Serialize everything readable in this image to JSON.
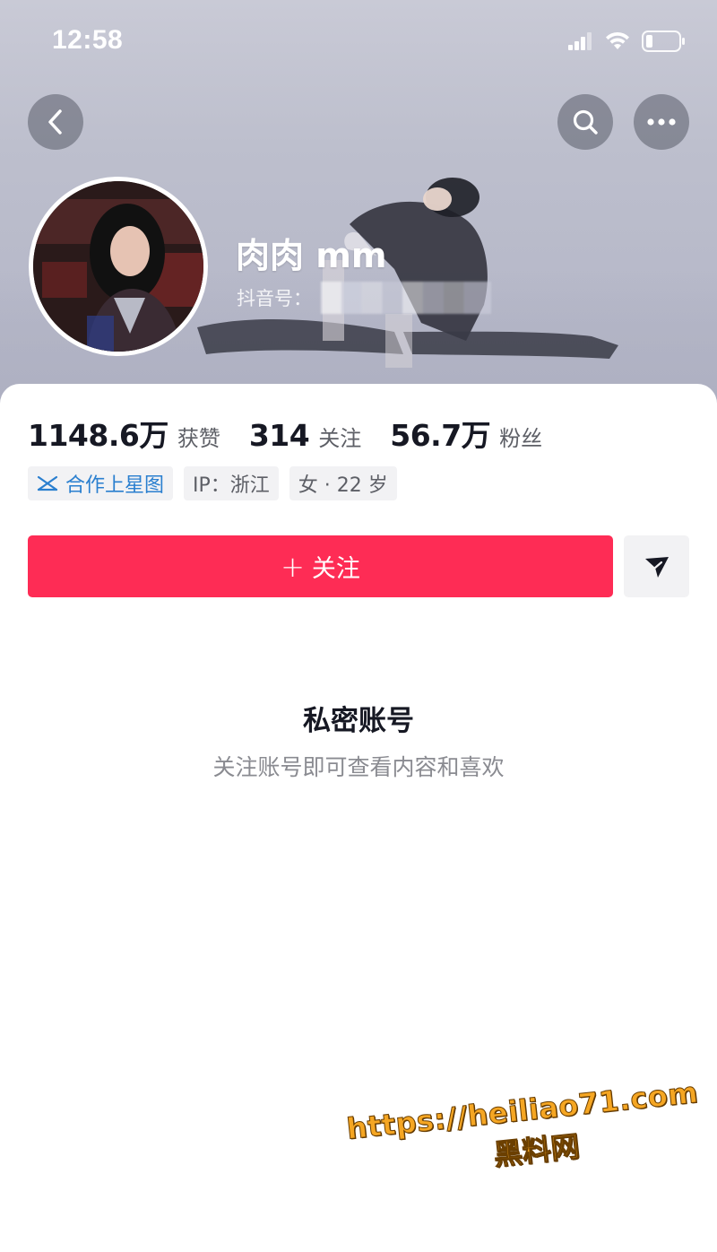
{
  "status_bar": {
    "time": "12:58",
    "icons": [
      "signal-icon",
      "wifi-icon",
      "battery-icon"
    ]
  },
  "nav": {
    "back_icon": "chevron-left-icon",
    "search_icon": "search-icon",
    "more_icon": "more-dots-icon"
  },
  "profile": {
    "nickname": "肉肉 mm",
    "douyin_id_label": "抖音号："
  },
  "stats": [
    {
      "value": "1148.6万",
      "label": "获赞"
    },
    {
      "value": "314",
      "label": "关注"
    },
    {
      "value": "56.7万",
      "label": "粉丝"
    }
  ],
  "tags": {
    "star": "合作上星图",
    "ip": "IP：浙江",
    "gender_age": "女 · 22 岁"
  },
  "actions": {
    "follow_plus": "+",
    "follow_label": "关注",
    "share_icon": "send-icon"
  },
  "private": {
    "title": "私密账号",
    "subtitle": "关注账号即可查看内容和喜欢"
  },
  "watermark": {
    "url": "https://heiliao71.com",
    "name": "黑料网"
  },
  "colors": {
    "accent": "#fe2c55",
    "star_blue": "#2a7fcf",
    "watermark": "#f5a623"
  }
}
